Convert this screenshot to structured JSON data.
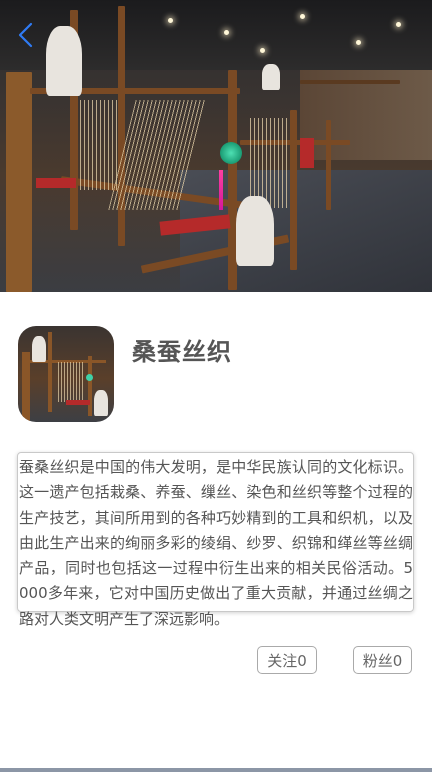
{
  "hero": {
    "image": "loom-workshop-photo"
  },
  "nav": {
    "back_icon": "chevron-left-icon",
    "accent": "#2f7bf5"
  },
  "profile": {
    "avatar": "loom-workshop-thumbnail",
    "title": "桑蚕丝织"
  },
  "description": {
    "text": "蚕桑丝织是中国的伟大发明，是中华民族认同的文化标识。这一遗产包括栽桑、养蚕、缫丝、染色和丝织等整个过程的生产技艺，其间所用到的各种巧妙精到的工具和织机，以及由此生产出来的绚丽多彩的绫绢、纱罗、织锦和缂丝等丝绸产品，同时也包括这一过程中衍生出来的相关民俗活动。5000多年来，它对中国历史做出了重大贡献，并通过丝绸之路对人类文明产生了深远影响。"
  },
  "stats": {
    "follow_label": "关注0",
    "fans_label": "粉丝0"
  }
}
